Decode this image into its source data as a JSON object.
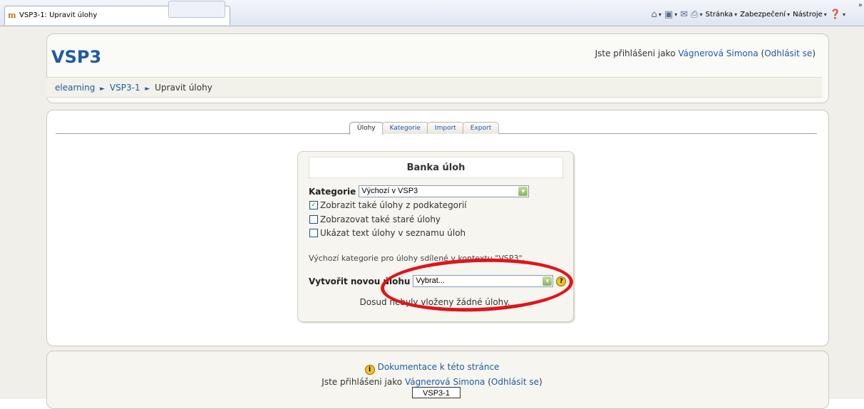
{
  "browser": {
    "tab_title": "VSP3-1: Upravit úlohy",
    "favicon": "moodle-icon",
    "toolbar": {
      "page_label": "Stránka",
      "security_label": "Zabezpečení",
      "tools_label": "Nástroje",
      "more": "»"
    }
  },
  "header": {
    "site_title": "VSP3",
    "login_prefix": "Jste přihlášeni jako",
    "user_name": "Vágnerová Simona",
    "logout": "Odhlásit se"
  },
  "breadcrumb": {
    "items": [
      "elearning",
      "VSP3-1",
      "Upravit úlohy"
    ],
    "separator": "►"
  },
  "tabs": [
    {
      "label": "Úlohy",
      "active": true
    },
    {
      "label": "Kategorie",
      "active": false
    },
    {
      "label": "Import",
      "active": false
    },
    {
      "label": "Export",
      "active": false
    }
  ],
  "bank": {
    "title": "Banka úloh",
    "category_label": "Kategorie",
    "category_value": "Výchozí v VSP3",
    "checkboxes": [
      {
        "label": "Zobrazit také úlohy z podkategorií",
        "checked": true
      },
      {
        "label": "Zobrazovat také staré úlohy",
        "checked": false
      },
      {
        "label": "Ukázat text úlohy v seznamu úloh",
        "checked": false
      }
    ],
    "default_note": "Výchozí kategorie pro úlohy sdílené v kontextu \"VSP3\".",
    "new_question_label": "Vytvořit novou úlohu",
    "new_question_value": "Vybrat...",
    "empty_message": "Dosud nebyly vloženy žádné úlohy."
  },
  "footer": {
    "doc_link": "Dokumentace k této stránce",
    "login_prefix": "Jste přihlášeni jako",
    "user_name": "Vágnerová Simona",
    "logout": "Odhlásit se",
    "course_button": "VSP3-1"
  },
  "colors": {
    "link": "#1f5aa6",
    "highlight_ellipse": "#e0141c"
  }
}
